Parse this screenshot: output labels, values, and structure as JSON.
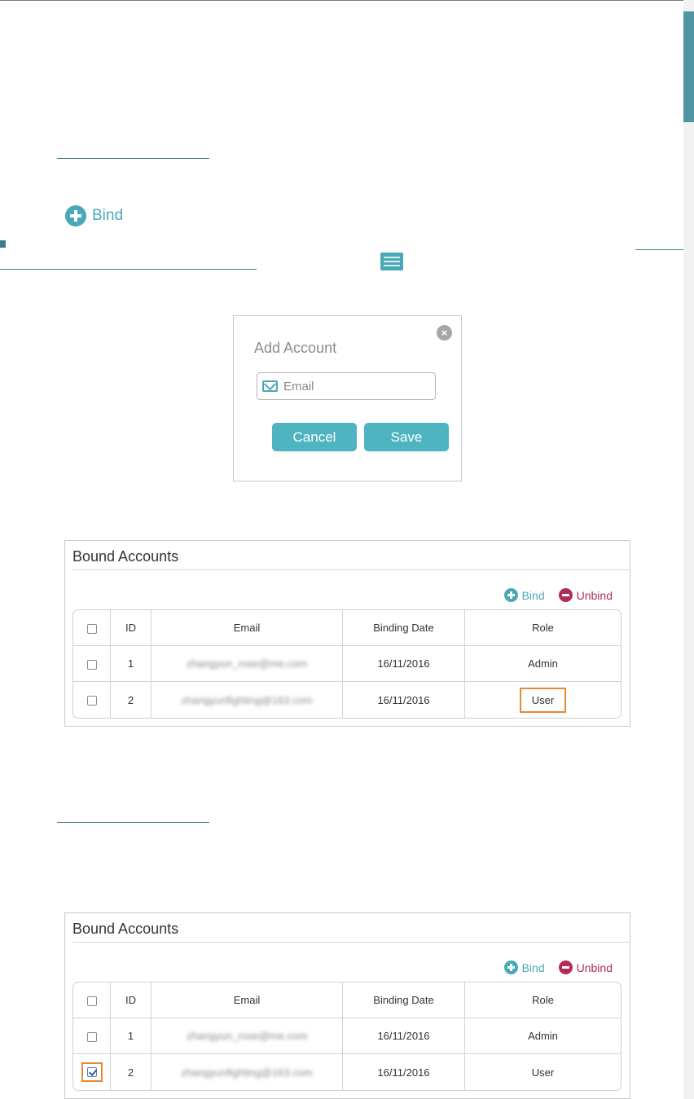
{
  "inline_bind": {
    "label": "Bind"
  },
  "dialog": {
    "title": "Add Account",
    "email_placeholder": "Email",
    "cancel_label": "Cancel",
    "save_label": "Save"
  },
  "panel_top": {
    "title": "Bound Accounts",
    "bind_label": "Bind",
    "unbind_label": "Unbind",
    "columns": [
      "ID",
      "Email",
      "Binding Date",
      "Role"
    ],
    "rows": [
      {
        "id": "1",
        "email": "zhangyun_rose@me.com",
        "date": "16/11/2016",
        "role": "Admin"
      },
      {
        "id": "2",
        "email": "zhangyunfighting@163.com",
        "date": "16/11/2016",
        "role": "User"
      }
    ]
  },
  "panel_bottom": {
    "title": "Bound Accounts",
    "bind_label": "Bind",
    "unbind_label": "Unbind",
    "columns": [
      "ID",
      "Email",
      "Binding Date",
      "Role"
    ],
    "rows": [
      {
        "id": "1",
        "email": "zhangyun_rose@me.com",
        "date": "16/11/2016",
        "role": "Admin"
      },
      {
        "id": "2",
        "email": "zhangyunfighting@163.com",
        "date": "16/11/2016",
        "role": "User"
      }
    ]
  },
  "colors": {
    "accent": "#4aa8b6",
    "unbind": "#b22a56",
    "highlight": "#e38a35"
  }
}
